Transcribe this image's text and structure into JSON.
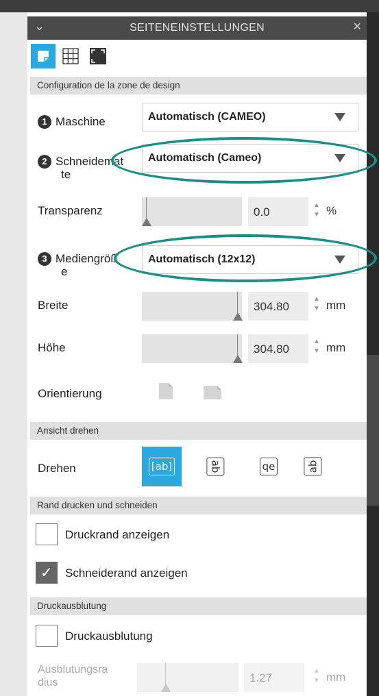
{
  "panel": {
    "title": "SEITENEINSTELLUNGEN",
    "tabs": [
      "page-setup-icon",
      "grid-icon",
      "registration-icon"
    ]
  },
  "design_area": {
    "section_title": "Configuration de la zone de design",
    "machine": {
      "step": "1",
      "label": "Maschine",
      "value": "Automatisch (CAMEO)"
    },
    "cutting_mat": {
      "step": "2",
      "label_line1": "Schneidemat",
      "label_line2": "te",
      "value": "Automatisch (Cameo)"
    },
    "transparency": {
      "label": "Transparenz",
      "value": "0.0",
      "unit": "%"
    },
    "media_size": {
      "step": "3",
      "label_line1": "Mediengröß",
      "label_line2": "e",
      "value": "Automatisch (12x12)"
    },
    "width": {
      "label": "Breite",
      "value": "304.80",
      "unit": "mm"
    },
    "height": {
      "label": "Höhe",
      "value": "304.80",
      "unit": "mm"
    },
    "orientation": {
      "label": "Orientierung"
    }
  },
  "rotate_view": {
    "section_title": "Ansicht drehen",
    "label": "Drehen",
    "options": [
      "[ab]",
      "ab",
      "qe",
      "ab"
    ],
    "selected": 0
  },
  "print_border": {
    "section_title": "Rand drucken und schneiden",
    "show_print_border": {
      "label": "Druckrand anzeigen",
      "checked": false
    },
    "show_cut_border": {
      "label": "Schneiderand anzeigen",
      "checked": true
    }
  },
  "bleed": {
    "section_title": "Druckausblutung",
    "enable": {
      "label": "Druckausblutung",
      "checked": false
    },
    "radius": {
      "label_line1": "Ausblutungsra",
      "label_line2": "dius",
      "value": "1.27",
      "unit": "mm"
    }
  },
  "colors": {
    "accent": "#29a9e0",
    "annotation": "#1a8f8a",
    "titlebar": "#4a4a4a"
  }
}
